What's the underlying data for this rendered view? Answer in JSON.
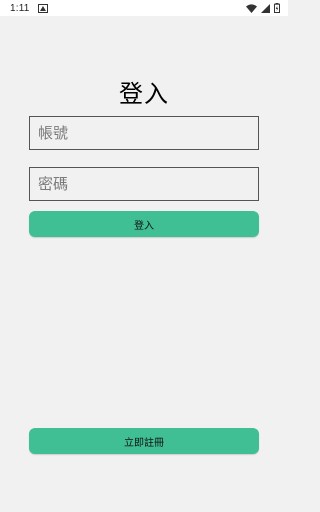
{
  "status_bar": {
    "time": "1:11",
    "icons": [
      "notification-icon",
      "wifi-icon",
      "signal-icon",
      "battery-icon"
    ]
  },
  "login": {
    "title": "登入",
    "account_placeholder": "帳號",
    "password_placeholder": "密碼",
    "login_button": "登入",
    "register_button": "立即註冊"
  },
  "colors": {
    "background": "#f1f1f1",
    "button": "#40bf94",
    "field_border": "#555555"
  }
}
